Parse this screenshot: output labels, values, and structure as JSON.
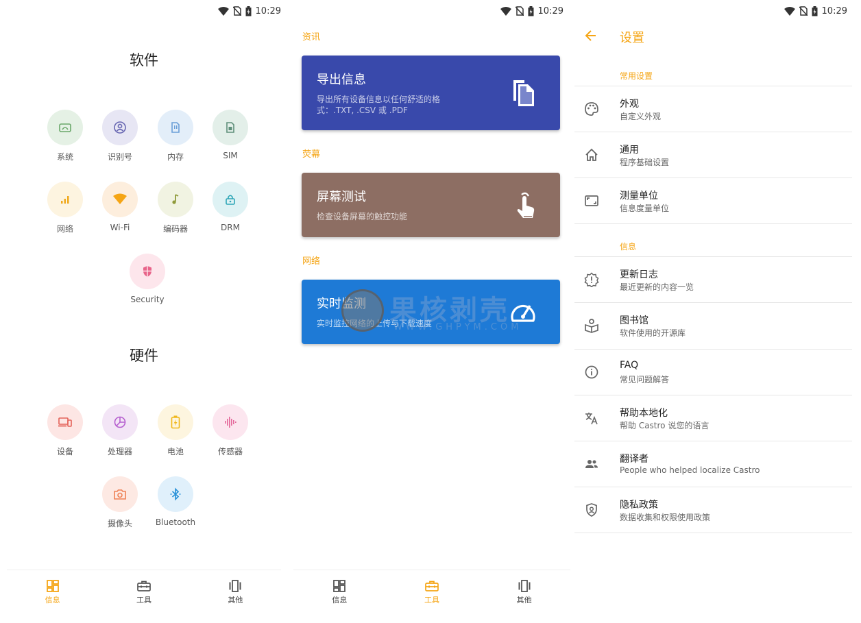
{
  "status": {
    "time": "10:29"
  },
  "screen1": {
    "software_title": "软件",
    "hardware_title": "硬件",
    "software_items": [
      {
        "label": "系统",
        "icon": "system-icon",
        "bg": "#e5f1e5",
        "color": "#6aa86a"
      },
      {
        "label": "识别号",
        "icon": "id-icon",
        "bg": "#e7e6f4",
        "color": "#6766b2"
      },
      {
        "label": "内存",
        "icon": "memory-icon",
        "bg": "#e3eef9",
        "color": "#6a9fd8"
      },
      {
        "label": "SIM",
        "icon": "sim-icon",
        "bg": "#e3efe9",
        "color": "#5f8f7a"
      },
      {
        "label": "网络",
        "icon": "network-icon",
        "bg": "#fdf4e0",
        "color": "#f0a81a"
      },
      {
        "label": "Wi-Fi",
        "icon": "wifi-icon",
        "bg": "#fdeedd",
        "color": "#f5a515"
      },
      {
        "label": "编码器",
        "icon": "codec-icon",
        "bg": "#f1f3e2",
        "color": "#8f9a3a"
      },
      {
        "label": "DRM",
        "icon": "drm-icon",
        "bg": "#def2f4",
        "color": "#2ea6b7"
      },
      {
        "label": "Security",
        "icon": "security-icon",
        "bg": "#fde6ec",
        "color": "#e8648a"
      }
    ],
    "hardware_items": [
      {
        "label": "设备",
        "icon": "device-icon",
        "bg": "#fde6e4",
        "color": "#e46259"
      },
      {
        "label": "处理器",
        "icon": "processor-icon",
        "bg": "#f3e5f6",
        "color": "#b55fcf"
      },
      {
        "label": "电池",
        "icon": "battery-icon",
        "bg": "#fdf5df",
        "color": "#f0b71a"
      },
      {
        "label": "传感器",
        "icon": "sensor-icon",
        "bg": "#fce6ef",
        "color": "#e4699b"
      },
      {
        "label": "摄像头",
        "icon": "camera-icon",
        "bg": "#fde9e3",
        "color": "#ef8054"
      },
      {
        "label": "Bluetooth",
        "icon": "bluetooth-icon",
        "bg": "#e0f0fb",
        "color": "#2a92d8"
      }
    ],
    "nav": [
      {
        "label": "信息",
        "icon": "dashboard-icon",
        "active": true
      },
      {
        "label": "工具",
        "icon": "toolbox-icon",
        "active": false
      },
      {
        "label": "其他",
        "icon": "carousel-icon",
        "active": false
      }
    ]
  },
  "screen2": {
    "sections": [
      {
        "label": "资讯",
        "card_title": "导出信息",
        "card_desc": "导出所有设备信息以任何舒适的格式：.TXT, .CSV 或 .PDF",
        "color": "#3949ab",
        "icon": "copy-icon"
      },
      {
        "label": "荧幕",
        "card_title": "屏幕测试",
        "card_desc": "检查设备屏幕的触控功能",
        "color": "#8d6e63",
        "icon": "touch-icon"
      },
      {
        "label": "网络",
        "card_title": "实时监测",
        "card_desc": "实时监控网络的上传与下载速度",
        "color": "#1e7ad6",
        "icon": "speedometer-icon"
      }
    ],
    "watermark": {
      "text": "果核剥壳",
      "url": "WWW.GHPYM.COM"
    },
    "nav": [
      {
        "label": "信息",
        "icon": "dashboard-icon",
        "active": false
      },
      {
        "label": "工具",
        "icon": "toolbox-icon",
        "active": true
      },
      {
        "label": "其他",
        "icon": "carousel-icon",
        "active": false
      }
    ]
  },
  "screen3": {
    "title": "设置",
    "groups": [
      {
        "label": "常用设置",
        "rows": [
          {
            "title": "外观",
            "subtitle": "自定义外观",
            "icon": "palette-icon"
          },
          {
            "title": "通用",
            "subtitle": "程序基础设置",
            "icon": "home-icon"
          },
          {
            "title": "测量单位",
            "subtitle": "信息度量单位",
            "icon": "aspect-ratio-icon"
          }
        ]
      },
      {
        "label": "信息",
        "rows": [
          {
            "title": "更新日志",
            "subtitle": "最近更新的内容一览",
            "icon": "new-releases-icon"
          },
          {
            "title": "图书馆",
            "subtitle": "软件使用的开源库",
            "icon": "library-icon"
          },
          {
            "title": "FAQ",
            "subtitle": "常见问题解答",
            "icon": "info-icon"
          },
          {
            "title": "帮助本地化",
            "subtitle": "帮助 Castro 说您的语言",
            "icon": "translate-icon"
          },
          {
            "title": "翻译者",
            "subtitle": "People who helped localize Castro",
            "icon": "people-icon"
          },
          {
            "title": "隐私政策",
            "subtitle": "数据收集和权限使用政策",
            "icon": "privacy-icon"
          }
        ]
      }
    ],
    "accent": "#f5a515"
  }
}
